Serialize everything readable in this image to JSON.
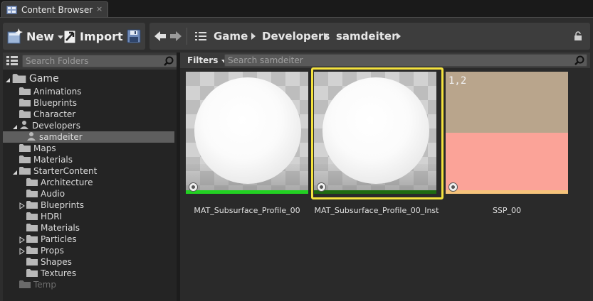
{
  "tab": {
    "title": "Content Browser",
    "close": "×",
    "icon": "content-browser-icon"
  },
  "toolbar": {
    "new_label": "New",
    "import_label": "Import",
    "save_icon": "save-all-icon",
    "back_icon": "back-arrow-icon",
    "forward_icon": "forward-arrow-icon",
    "history_icon": "path-list-icon",
    "lock_icon": "lock-icon"
  },
  "breadcrumb": [
    "Game",
    "Developers",
    "samdeiter"
  ],
  "sources": {
    "search_placeholder": "Search Folders",
    "tree": [
      {
        "label": "Game",
        "depth": 0,
        "expander": "open",
        "kind": "root"
      },
      {
        "label": "Animations",
        "depth": 1,
        "expander": "none",
        "kind": "folder"
      },
      {
        "label": "Blueprints",
        "depth": 1,
        "expander": "none",
        "kind": "folder"
      },
      {
        "label": "Character",
        "depth": 1,
        "expander": "none",
        "kind": "folder"
      },
      {
        "label": "Developers",
        "depth": 1,
        "expander": "open",
        "kind": "user"
      },
      {
        "label": "samdeiter",
        "depth": 2,
        "expander": "none",
        "kind": "user",
        "selected": true
      },
      {
        "label": "Maps",
        "depth": 1,
        "expander": "none",
        "kind": "folder"
      },
      {
        "label": "Materials",
        "depth": 1,
        "expander": "none",
        "kind": "folder"
      },
      {
        "label": "StarterContent",
        "depth": 1,
        "expander": "open",
        "kind": "folder"
      },
      {
        "label": "Architecture",
        "depth": 2,
        "expander": "none",
        "kind": "folder"
      },
      {
        "label": "Audio",
        "depth": 2,
        "expander": "none",
        "kind": "folder"
      },
      {
        "label": "Blueprints",
        "depth": 2,
        "expander": "closed",
        "kind": "folder"
      },
      {
        "label": "HDRI",
        "depth": 2,
        "expander": "none",
        "kind": "folder"
      },
      {
        "label": "Materials",
        "depth": 2,
        "expander": "none",
        "kind": "folder"
      },
      {
        "label": "Particles",
        "depth": 2,
        "expander": "closed",
        "kind": "folder"
      },
      {
        "label": "Props",
        "depth": 2,
        "expander": "closed",
        "kind": "folder"
      },
      {
        "label": "Shapes",
        "depth": 2,
        "expander": "none",
        "kind": "folder"
      },
      {
        "label": "Textures",
        "depth": 2,
        "expander": "none",
        "kind": "folder"
      },
      {
        "label": "Temp",
        "depth": 1,
        "expander": "none",
        "kind": "folder",
        "disabled": true
      }
    ]
  },
  "assets": {
    "filters_label": "Filters",
    "search_placeholder": "Search samdeiter",
    "items": [
      {
        "name": "MAT_Subsurface_Profile_00",
        "preview": "sphere",
        "type_color": "#22d022",
        "selected": false
      },
      {
        "name": "MAT_Subsurface_Profile_00_Inst",
        "preview": "sphere",
        "type_color": "#1f6b12",
        "selected": true
      },
      {
        "name": "SSP_00",
        "preview": "profile",
        "corner_text": "1,2",
        "type_color": "#f5c27a",
        "swatch_top": "#b9a58c",
        "swatch_bottom": "#fba398",
        "selected": false
      }
    ]
  },
  "colors": {
    "selection_outline": "#f4e23e",
    "folder": "#b8b8b8",
    "panel_bg": "#2d2d2d"
  }
}
